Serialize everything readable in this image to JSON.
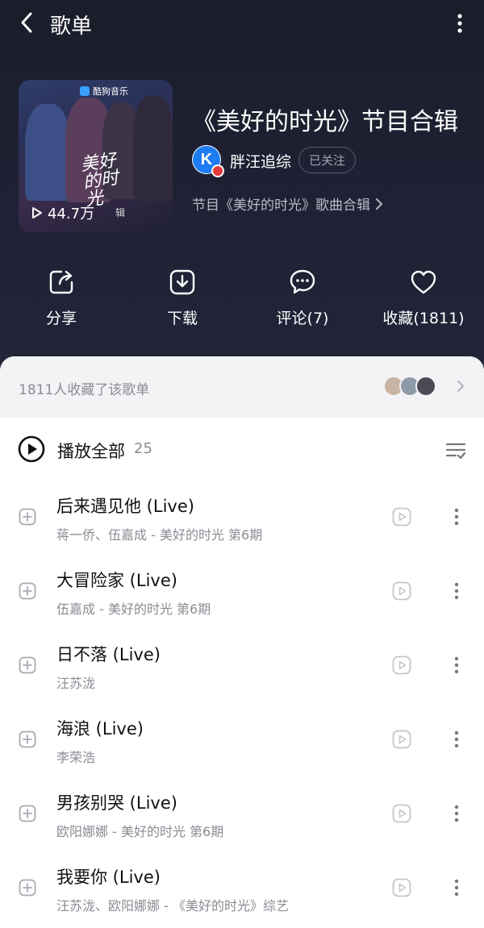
{
  "header": {
    "title": "歌单"
  },
  "playlist": {
    "cover": {
      "logo_text": "酷狗音乐",
      "art_title": "美好的时光",
      "play_count": "44.7万",
      "tag": "辑"
    },
    "title": "《美好的时光》节目合辑",
    "author": {
      "avatar_letter": "K",
      "name": "胖汪追综",
      "follow_label": "已关注"
    },
    "description": "节目《美好的时光》歌曲合辑"
  },
  "actions": [
    {
      "label": "分享",
      "icon": "share-icon"
    },
    {
      "label": "下载",
      "icon": "download-icon"
    },
    {
      "label": "评论(7)",
      "icon": "comment-icon"
    },
    {
      "label": "收藏(1811)",
      "icon": "heart-icon"
    }
  ],
  "collectors": {
    "text": "1811人收藏了该歌单"
  },
  "play_all": {
    "label": "播放全部",
    "count": "25"
  },
  "songs": [
    {
      "title": "后来遇见他 (Live)",
      "subtitle": "蒋一侨、伍嘉成 - 美好的时光 第6期"
    },
    {
      "title": "大冒险家 (Live)",
      "subtitle": "伍嘉成 - 美好的时光 第6期"
    },
    {
      "title": "日不落 (Live)",
      "subtitle": "汪苏泷"
    },
    {
      "title": "海浪 (Live)",
      "subtitle": "李荣浩"
    },
    {
      "title": "男孩别哭 (Live)",
      "subtitle": "欧阳娜娜 - 美好的时光 第6期"
    },
    {
      "title": "我要你 (Live)",
      "subtitle": "汪苏泷、欧阳娜娜 - 《美好的时光》综艺"
    }
  ],
  "colors": {
    "hero_bg": "#1e2133",
    "sheet_bg": "#ffffff",
    "collectors_bg": "#f3f3f5",
    "brand_blue": "#1e7cf2",
    "muted_text": "#8a8c94"
  }
}
